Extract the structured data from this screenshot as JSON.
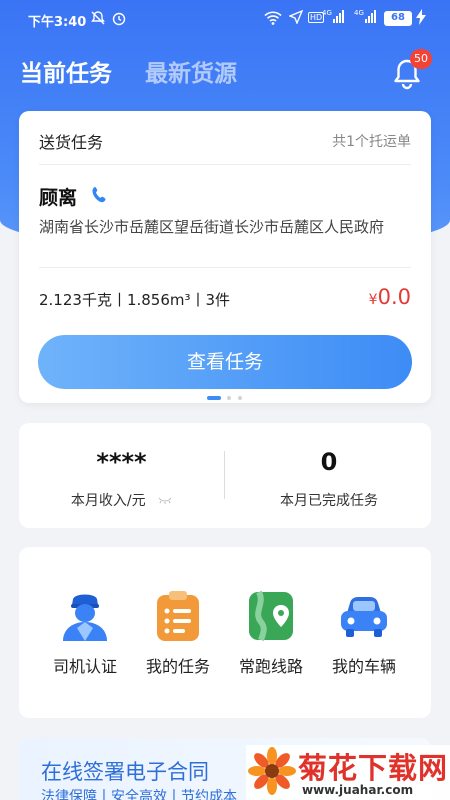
{
  "status_bar": {
    "time": "下午3:40",
    "network_badge": "HD",
    "signal1": "4G",
    "signal2": "4G",
    "battery": "68"
  },
  "tabs": [
    {
      "label": "当前任务",
      "active": true
    },
    {
      "label": "最新货源",
      "active": false
    }
  ],
  "notifications": {
    "count": "50"
  },
  "task_card": {
    "title": "送货任务",
    "count_text": "共1个托运单",
    "receiver_name": "顾离",
    "address": "湖南省长沙市岳麓区望岳街道长沙市岳麓区人民政府",
    "cargo_info": "2.123千克丨1.856m³丨3件",
    "price_currency": "¥",
    "price_amount": "0.0",
    "button_label": "查看任务",
    "carousel": {
      "pages": 3,
      "current": 1
    }
  },
  "stats": {
    "income_value": "****",
    "income_label": "本月收入/元",
    "completed_value": "0",
    "completed_label": "本月已完成任务"
  },
  "menu": [
    {
      "label": "司机认证",
      "icon": "driver-icon"
    },
    {
      "label": "我的任务",
      "icon": "task-clipboard-icon"
    },
    {
      "label": "常跑线路",
      "icon": "route-map-icon"
    },
    {
      "label": "我的车辆",
      "icon": "car-icon"
    }
  ],
  "banner": {
    "title": "在线签署电子合同",
    "subtitle": "法律保障丨安全高效丨节约成本"
  },
  "watermark": {
    "text": "菊花下载网",
    "url": "www.juahar.com"
  },
  "colors": {
    "primary": "#3a74f5",
    "price": "#e53935",
    "background": "#f1f3f7"
  }
}
